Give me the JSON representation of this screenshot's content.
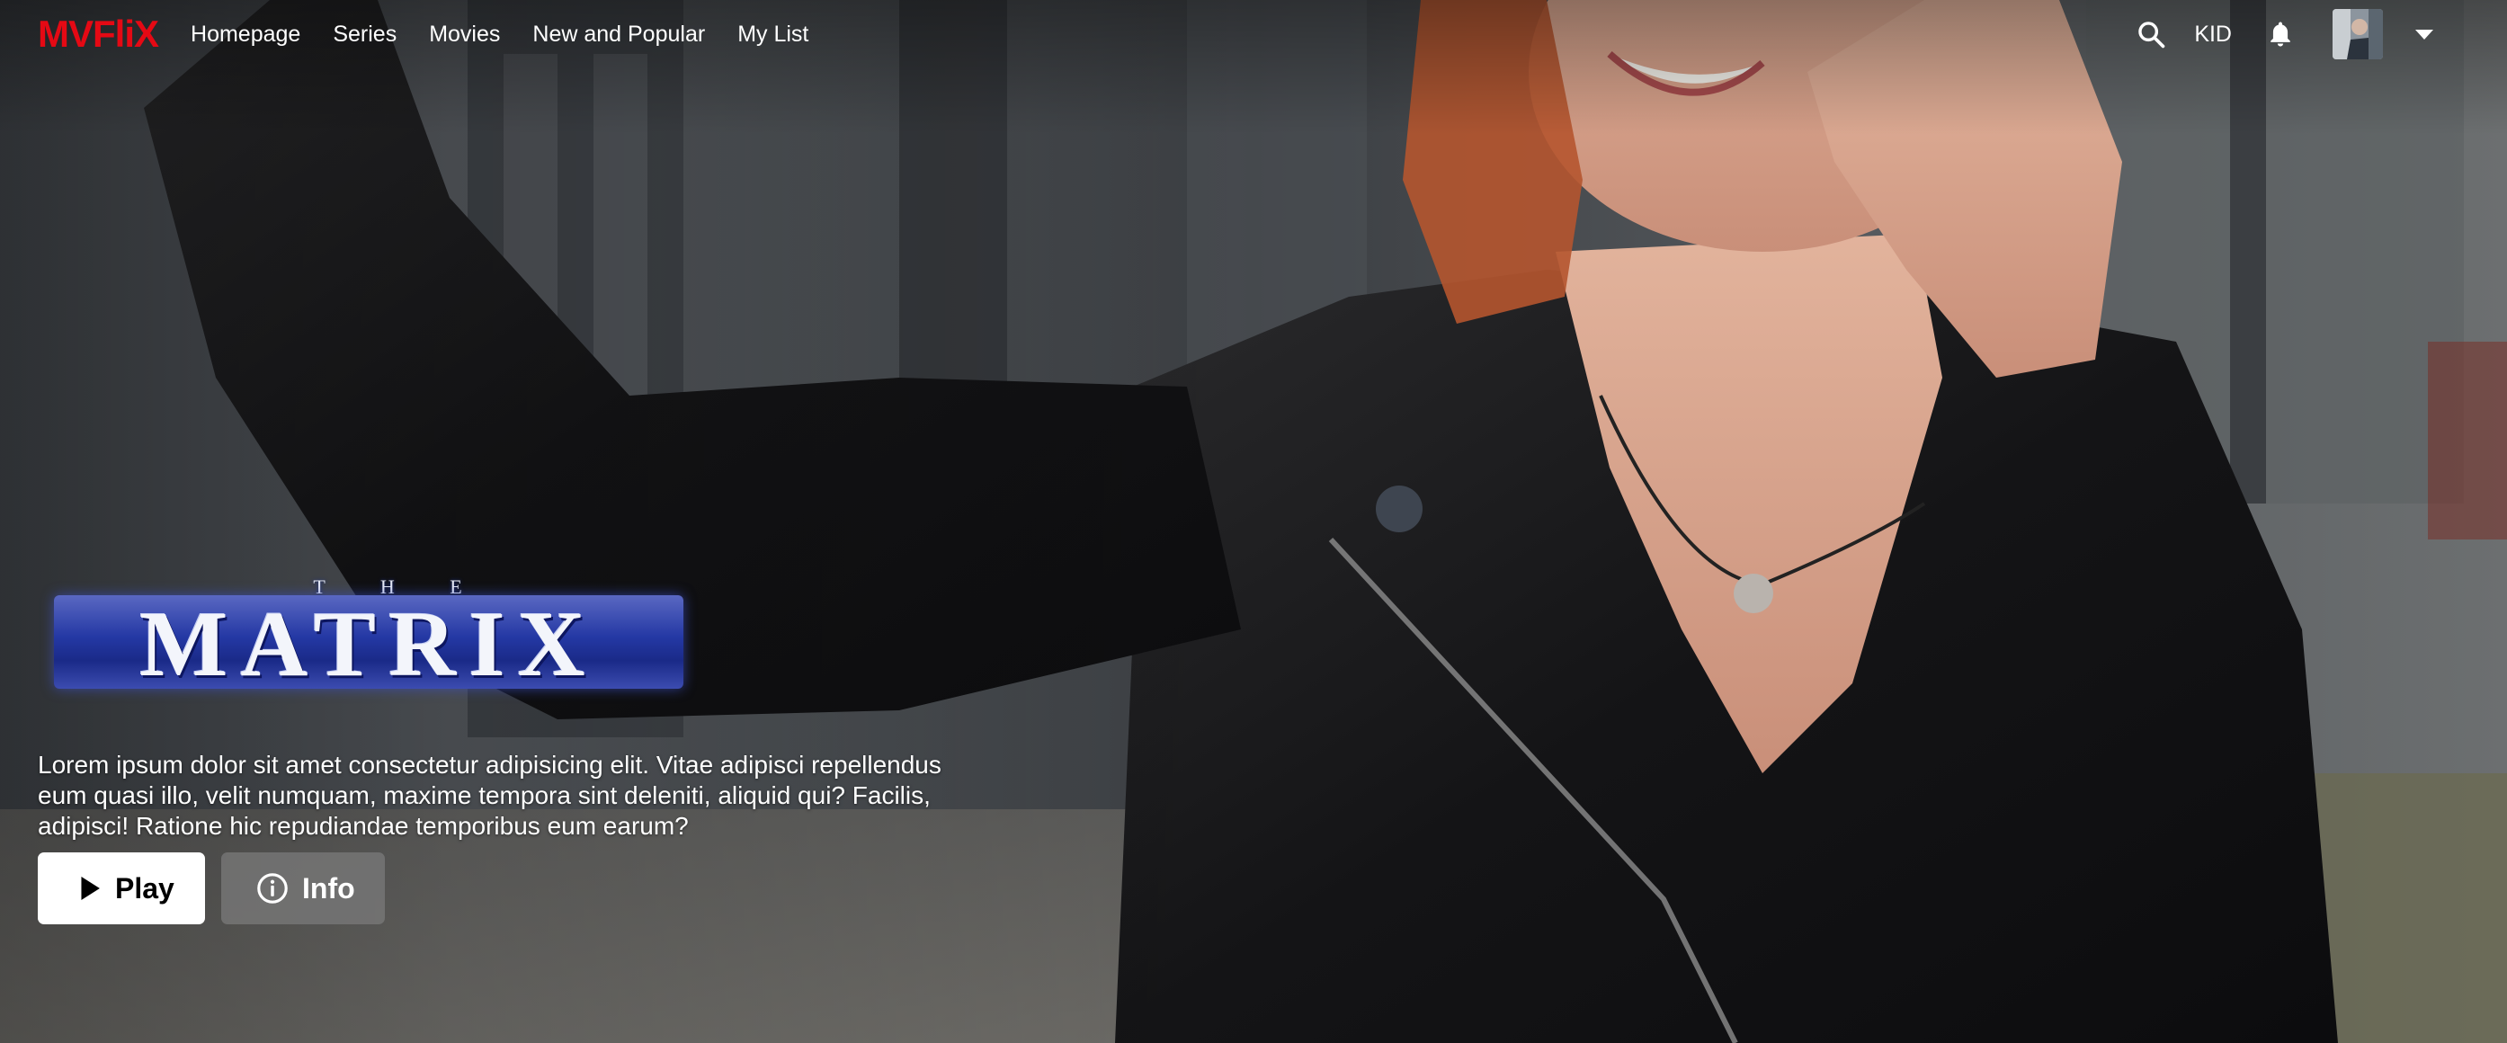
{
  "brand": "MVFliX",
  "nav": {
    "links": [
      "Homepage",
      "Series",
      "Movies",
      "New and Popular",
      "My List"
    ],
    "kid_label": "KID",
    "icons": [
      "search-icon",
      "bell-icon",
      "avatar",
      "caret-down-icon"
    ]
  },
  "hero": {
    "logo": {
      "small": "T H E",
      "main": "MATRIX"
    },
    "description": "Lorem ipsum dolor sit amet consectetur adipisicing elit. Vitae adipisci repellendus eum quasi illo, velit numquam, maxime tempora sint deleniti, aliquid qui? Facilis, adipisci! Ratione hic repudiandae temporibus eum earum?",
    "buttons": {
      "play": "Play",
      "info": "Info"
    }
  },
  "colors": {
    "brand": "#e50914",
    "play_bg": "#ffffff",
    "info_bg": "#787878"
  }
}
